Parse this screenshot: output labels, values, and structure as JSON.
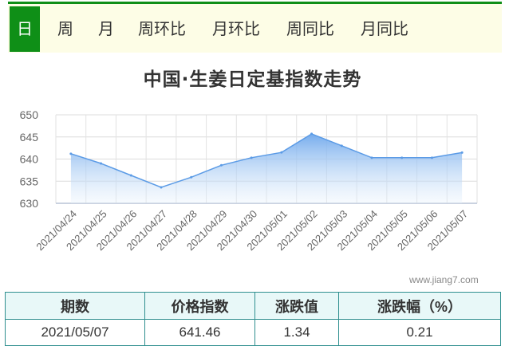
{
  "tabs": [
    {
      "label": "日",
      "active": true
    },
    {
      "label": "周",
      "active": false
    },
    {
      "label": "月",
      "active": false
    },
    {
      "label": "周环比",
      "active": false
    },
    {
      "label": "月环比",
      "active": false
    },
    {
      "label": "周同比",
      "active": false
    },
    {
      "label": "月同比",
      "active": false
    }
  ],
  "colors": {
    "tab_active": "#0f8f17",
    "tabbar_bg": "#fdfde6",
    "area_top": "#6fa8ec",
    "line": "#5b9be6",
    "table_border": "#2f8f8f"
  },
  "watermark": "www.jiang7.com",
  "chart_data": {
    "type": "area",
    "title": "中国·生姜日定基指数走势",
    "categories": [
      "2021/04/24",
      "2021/04/25",
      "2021/04/26",
      "2021/04/27",
      "2021/04/28",
      "2021/04/29",
      "2021/04/30",
      "2021/05/01",
      "2021/05/02",
      "2021/05/03",
      "2021/05/04",
      "2021/05/05",
      "2021/05/06",
      "2021/05/07"
    ],
    "series": [
      {
        "values": [
          641.2,
          639.0,
          636.3,
          633.6,
          635.9,
          638.6,
          640.3,
          641.5,
          645.7,
          643.0,
          640.3,
          640.3,
          640.3,
          641.46
        ]
      }
    ],
    "ylim": [
      630,
      650
    ],
    "yticks": [
      630,
      635,
      640,
      645,
      650
    ],
    "xlabel": "",
    "ylabel": "",
    "grid": true
  },
  "table": {
    "headers": [
      "期数",
      "价格指数",
      "涨跌值",
      "涨跌幅（%）"
    ],
    "rows": [
      [
        "2021/05/07",
        "641.46",
        "1.34",
        "0.21"
      ]
    ]
  }
}
